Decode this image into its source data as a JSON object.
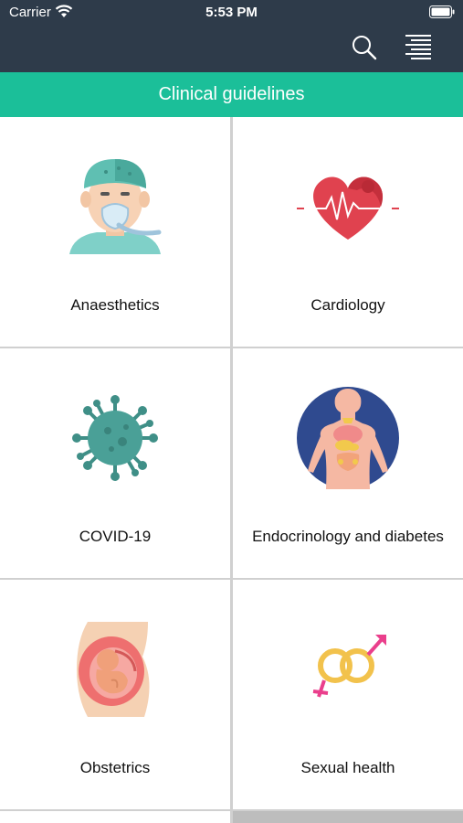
{
  "status_bar": {
    "carrier": "Carrier",
    "time": "5:53 PM"
  },
  "toolbar": {
    "search_icon": "search-icon",
    "menu_icon": "menu-icon"
  },
  "header": {
    "title": "Clinical guidelines",
    "color": "#1bbf99"
  },
  "colors": {
    "topbar": "#2e3b4a",
    "accent": "#1bbf99"
  },
  "categories": [
    {
      "label": "Anaesthetics",
      "icon": "anaesthetist-icon"
    },
    {
      "label": "Cardiology",
      "icon": "heart-icon"
    },
    {
      "label": "COVID-19",
      "icon": "virus-icon"
    },
    {
      "label": "Endocrinology and diabetes",
      "icon": "body-organs-icon"
    },
    {
      "label": "Obstetrics",
      "icon": "pregnancy-icon"
    },
    {
      "label": "Sexual health",
      "icon": "gender-symbols-icon"
    }
  ]
}
